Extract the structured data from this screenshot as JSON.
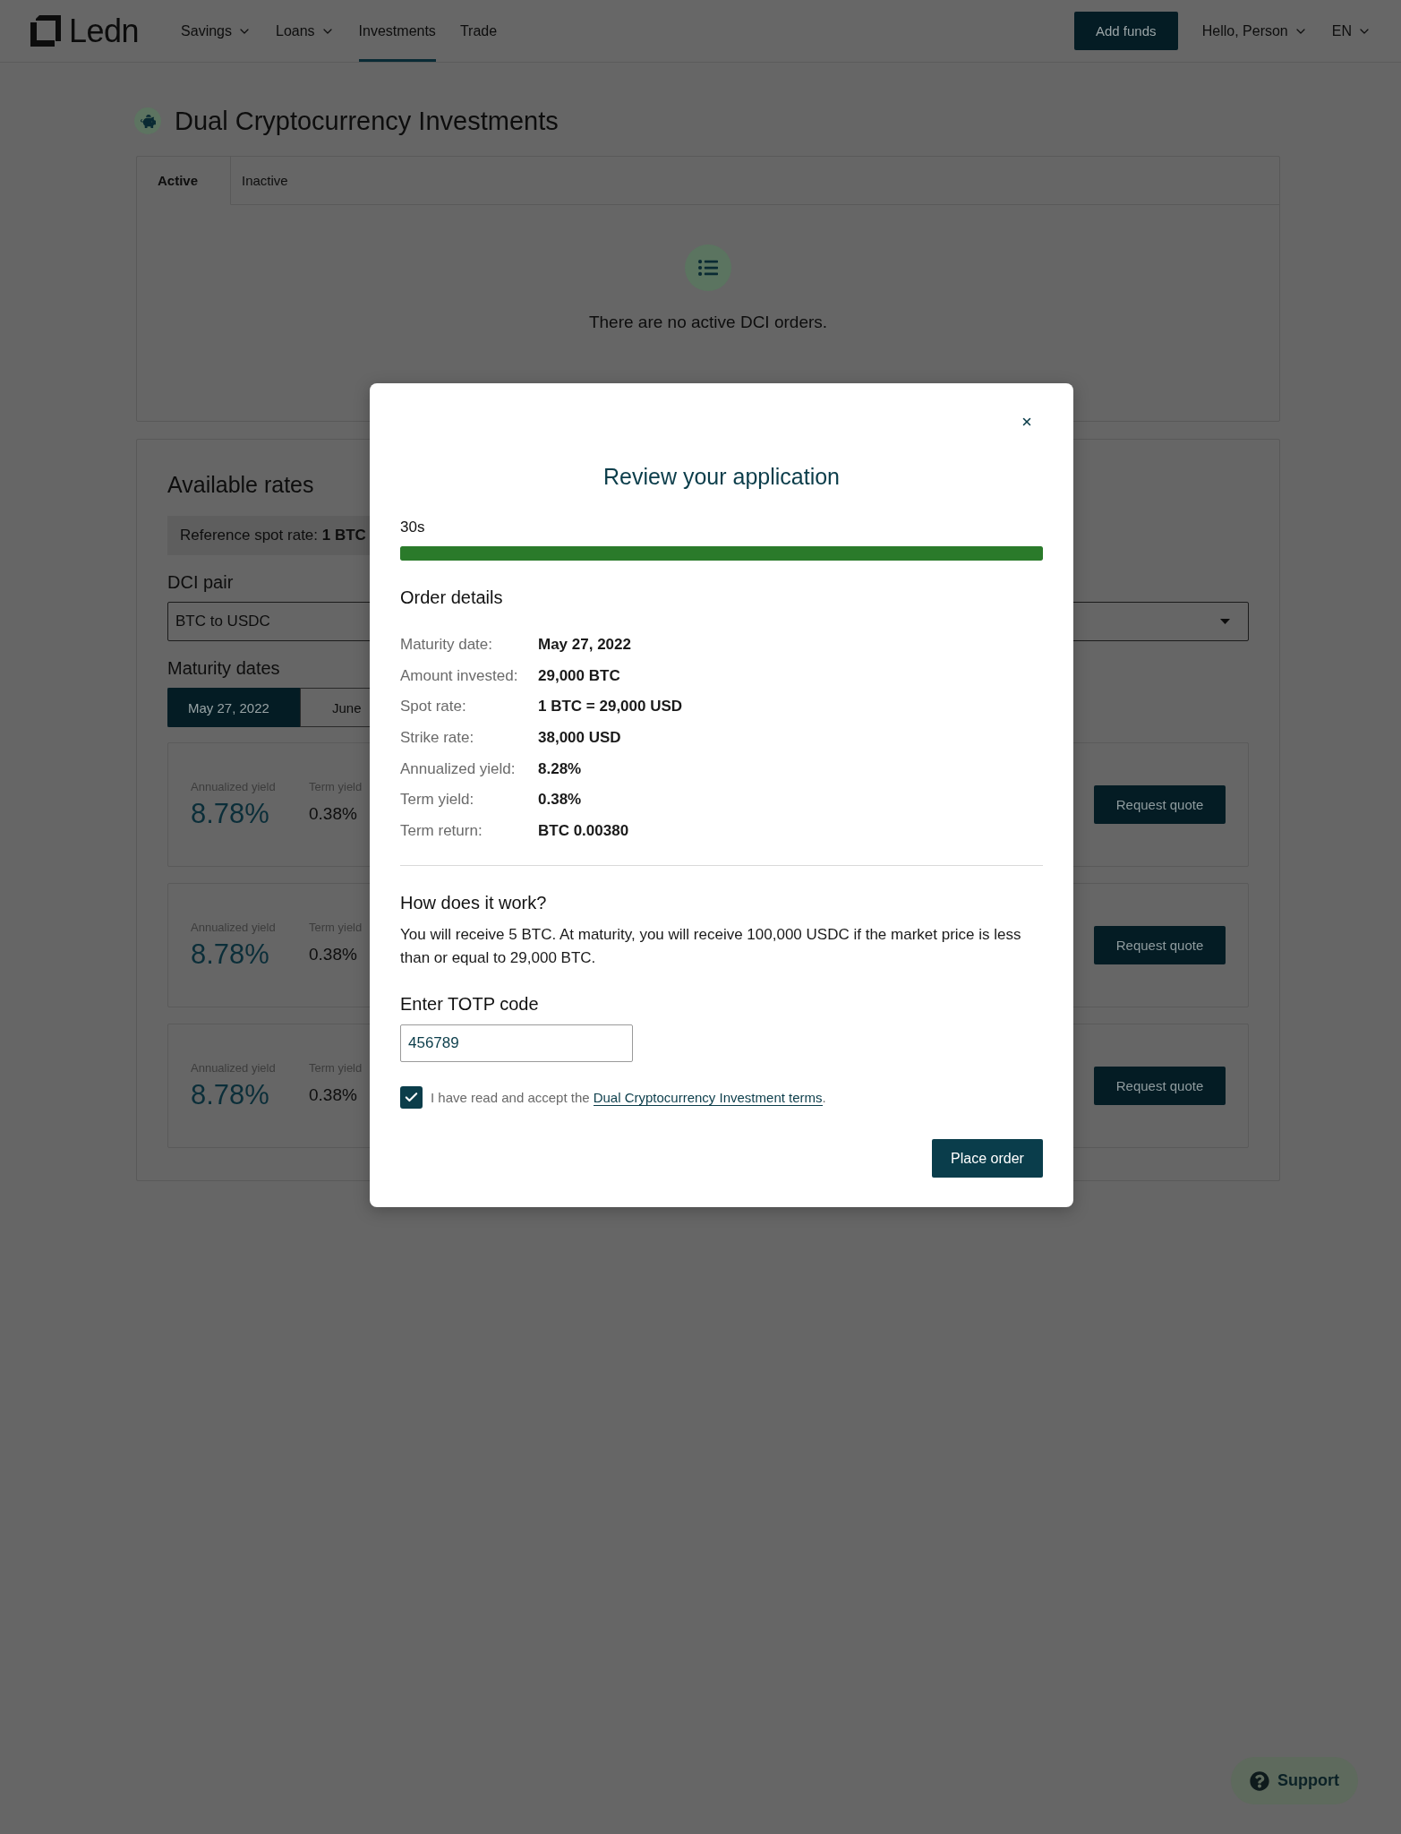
{
  "nav": {
    "logo": "Ledn",
    "items": [
      {
        "label": "Savings",
        "dropdown": true,
        "selected": false
      },
      {
        "label": "Loans",
        "dropdown": true,
        "selected": false
      },
      {
        "label": "Investments",
        "dropdown": false,
        "selected": true
      },
      {
        "label": "Trade",
        "dropdown": false,
        "selected": false
      }
    ],
    "add_funds": "Add funds",
    "user_menu": "Hello, Person",
    "language": "EN"
  },
  "page": {
    "title": "Dual Cryptocurrency Investments"
  },
  "orders": {
    "tabs": [
      {
        "label": "Active",
        "selected": true
      },
      {
        "label": "Inactive",
        "selected": false
      }
    ],
    "empty_message": "There are no active DCI orders."
  },
  "rates": {
    "title": "Available rates",
    "spot_rate": "Reference spot rate: **1 BTC**",
    "pair_label": "DCI pair",
    "pair_value": "BTC to USDC",
    "maturity_label": "Maturity dates",
    "dates": [
      {
        "label": "May 27, 2022",
        "selected": true
      },
      {
        "label": "June",
        "selected": false
      }
    ],
    "cards": [
      {
        "annualized_label": "Annualized yield",
        "annualized_value": "8.78%",
        "term_label": "Term yield",
        "term_value": "0.38%",
        "action": "Request quote"
      },
      {
        "annualized_label": "Annualized yield",
        "annualized_value": "8.78%",
        "term_label": "Term yield",
        "term_value": "0.38%",
        "action": "Request quote"
      },
      {
        "annualized_label": "Annualized yield",
        "annualized_value": "8.78%",
        "term_label": "Term yield",
        "term_value": "0.38%",
        "action": "Request quote"
      }
    ]
  },
  "modal": {
    "title": "Review your application",
    "countdown": {
      "text": "30s",
      "level": 1
    },
    "order_details": {
      "title": "Order details",
      "rows": [
        {
          "label": "Maturity date:",
          "value": "May 27, 2022"
        },
        {
          "label": "Amount invested:",
          "value": "29,000 BTC"
        },
        {
          "label": "Spot rate:",
          "value": "1 BTC = 29,000 USD"
        },
        {
          "label": "Strike rate:",
          "value": "38,000 USD"
        },
        {
          "label": "Annualized yield:",
          "value": "8.28%"
        },
        {
          "label": "Term yield:",
          "value": "0.38%"
        },
        {
          "label": "Term return:",
          "value": "BTC 0.00380"
        }
      ]
    },
    "how_it_works": {
      "title": "How does it work?",
      "text": "You will receive 5 BTC. At maturity, you will receive 100,000 USDC if the market price is less than or equal to 29,000 BTC."
    },
    "totp": {
      "label": "Enter TOTP code",
      "value": "456789"
    },
    "terms": {
      "checked": true,
      "text": "I have read and accept the",
      "link": "Dual Cryptocurrency Investment terms",
      "suffix": "."
    },
    "submit": "Place order"
  },
  "support": {
    "label": "Support"
  }
}
